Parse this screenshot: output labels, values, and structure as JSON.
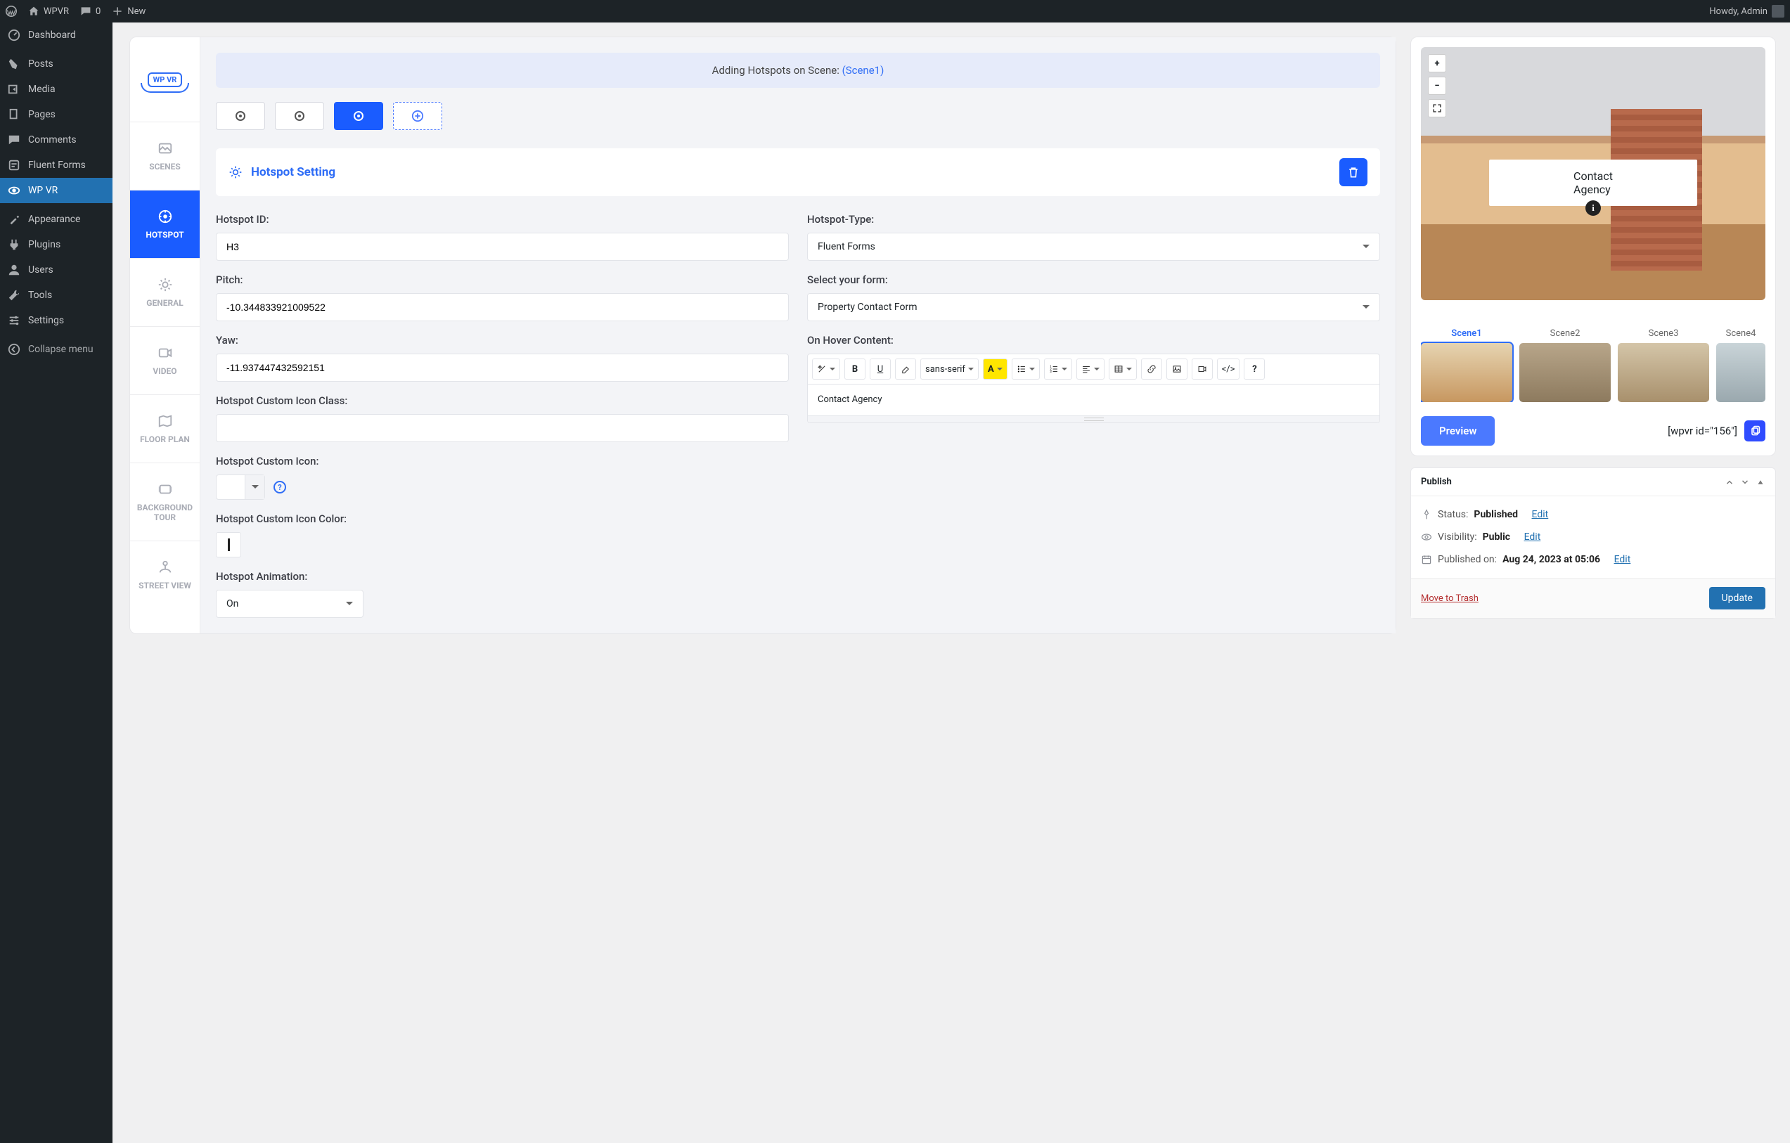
{
  "adminbar": {
    "site": "WPVR",
    "comments": "0",
    "new": "New",
    "howdy": "Howdy, Admin"
  },
  "sidebar": {
    "items": [
      {
        "label": "Dashboard",
        "icon": "dashboard"
      },
      {
        "label": "Posts",
        "icon": "pin"
      },
      {
        "label": "Media",
        "icon": "media"
      },
      {
        "label": "Pages",
        "icon": "page"
      },
      {
        "label": "Comments",
        "icon": "comment"
      },
      {
        "label": "Fluent Forms",
        "icon": "form"
      },
      {
        "label": "WP VR",
        "icon": "vr"
      },
      {
        "label": "Appearance",
        "icon": "brush"
      },
      {
        "label": "Plugins",
        "icon": "plug"
      },
      {
        "label": "Users",
        "icon": "user"
      },
      {
        "label": "Tools",
        "icon": "wrench"
      },
      {
        "label": "Settings",
        "icon": "sliders"
      }
    ],
    "collapse": "Collapse menu"
  },
  "wpvr": {
    "logo": "WP VR",
    "tabs": {
      "scenes": "SCENES",
      "hotspot": "HOTSPOT",
      "general": "GENERAL",
      "video": "VIDEO",
      "floor": "FLOOR PLAN",
      "bgtour": "BACKGROUND TOUR",
      "street": "STREET VIEW"
    }
  },
  "scene_banner": {
    "prefix": "Adding Hotspots on Scene: ",
    "scene": "(Scene1)"
  },
  "hotspot_setting_title": "Hotspot Setting",
  "form": {
    "hotspot_id_label": "Hotspot ID:",
    "hotspot_id_value": "H3",
    "hotspot_type_label": "Hotspot-Type:",
    "hotspot_type_value": "Fluent Forms",
    "pitch_label": "Pitch:",
    "pitch_value": "-10.344833921009522",
    "select_form_label": "Select your form:",
    "select_form_value": "Property Contact Form",
    "yaw_label": "Yaw:",
    "yaw_value": "-11.937447432592151",
    "hover_label": "On Hover Content:",
    "icon_class_label": "Hotspot Custom Icon Class:",
    "icon_class_value": "",
    "custom_icon_label": "Hotspot Custom Icon:",
    "icon_color_label": "Hotspot Custom Icon Color:",
    "animation_label": "Hotspot Animation:",
    "animation_value": "On"
  },
  "rte": {
    "font": "sans-serif",
    "content": "Contact Agency"
  },
  "preview": {
    "hover_text": "Contact Agency",
    "scene1": "Scene1",
    "scene2": "Scene2",
    "scene3": "Scene3",
    "scene4": "Scene4",
    "preview_btn": "Preview",
    "shortcode": "[wpvr id=\"156\"]"
  },
  "publish": {
    "title": "Publish",
    "status_label": "Status: ",
    "status_value": "Published",
    "edit": "Edit",
    "visibility_label": "Visibility: ",
    "visibility_value": "Public",
    "published_label": "Published on: ",
    "published_value": "Aug 24, 2023 at 05:06",
    "trash": "Move to Trash",
    "update": "Update"
  }
}
